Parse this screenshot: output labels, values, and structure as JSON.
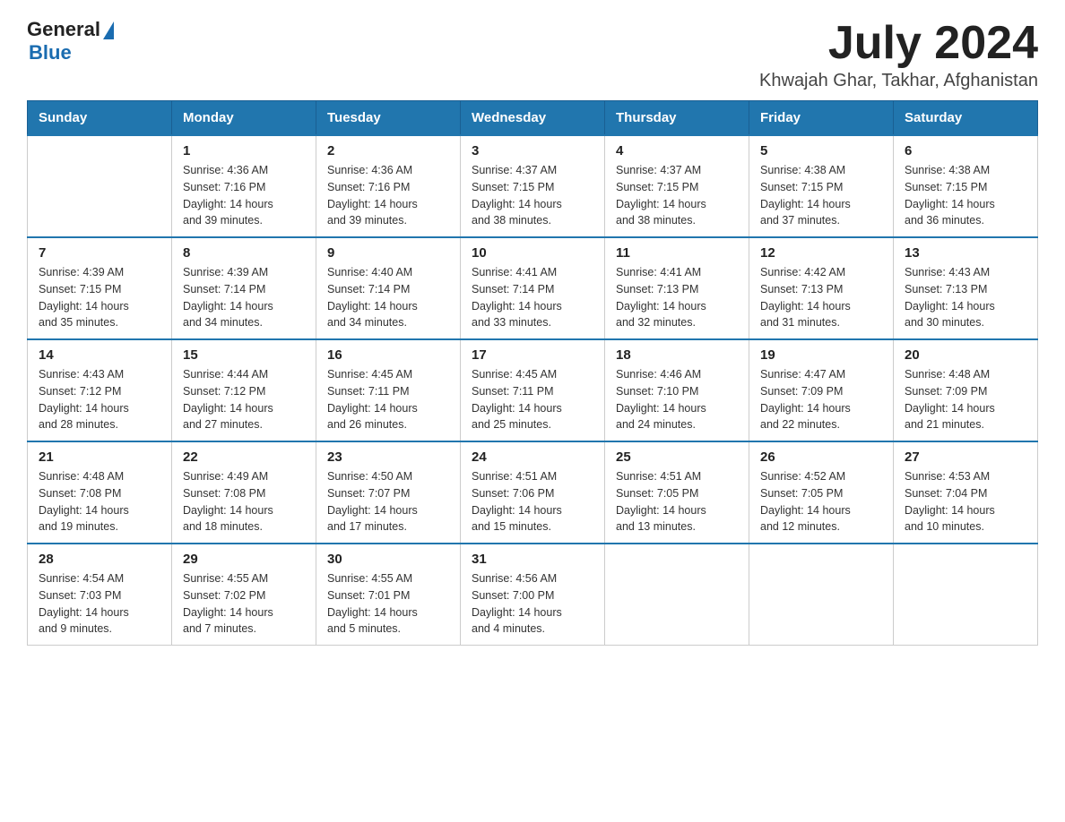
{
  "logo": {
    "text_general": "General",
    "text_blue": "Blue"
  },
  "title": "July 2024",
  "subtitle": "Khwajah Ghar, Takhar, Afghanistan",
  "headers": [
    "Sunday",
    "Monday",
    "Tuesday",
    "Wednesday",
    "Thursday",
    "Friday",
    "Saturday"
  ],
  "weeks": [
    [
      {
        "day": "",
        "info": ""
      },
      {
        "day": "1",
        "info": "Sunrise: 4:36 AM\nSunset: 7:16 PM\nDaylight: 14 hours\nand 39 minutes."
      },
      {
        "day": "2",
        "info": "Sunrise: 4:36 AM\nSunset: 7:16 PM\nDaylight: 14 hours\nand 39 minutes."
      },
      {
        "day": "3",
        "info": "Sunrise: 4:37 AM\nSunset: 7:15 PM\nDaylight: 14 hours\nand 38 minutes."
      },
      {
        "day": "4",
        "info": "Sunrise: 4:37 AM\nSunset: 7:15 PM\nDaylight: 14 hours\nand 38 minutes."
      },
      {
        "day": "5",
        "info": "Sunrise: 4:38 AM\nSunset: 7:15 PM\nDaylight: 14 hours\nand 37 minutes."
      },
      {
        "day": "6",
        "info": "Sunrise: 4:38 AM\nSunset: 7:15 PM\nDaylight: 14 hours\nand 36 minutes."
      }
    ],
    [
      {
        "day": "7",
        "info": "Sunrise: 4:39 AM\nSunset: 7:15 PM\nDaylight: 14 hours\nand 35 minutes."
      },
      {
        "day": "8",
        "info": "Sunrise: 4:39 AM\nSunset: 7:14 PM\nDaylight: 14 hours\nand 34 minutes."
      },
      {
        "day": "9",
        "info": "Sunrise: 4:40 AM\nSunset: 7:14 PM\nDaylight: 14 hours\nand 34 minutes."
      },
      {
        "day": "10",
        "info": "Sunrise: 4:41 AM\nSunset: 7:14 PM\nDaylight: 14 hours\nand 33 minutes."
      },
      {
        "day": "11",
        "info": "Sunrise: 4:41 AM\nSunset: 7:13 PM\nDaylight: 14 hours\nand 32 minutes."
      },
      {
        "day": "12",
        "info": "Sunrise: 4:42 AM\nSunset: 7:13 PM\nDaylight: 14 hours\nand 31 minutes."
      },
      {
        "day": "13",
        "info": "Sunrise: 4:43 AM\nSunset: 7:13 PM\nDaylight: 14 hours\nand 30 minutes."
      }
    ],
    [
      {
        "day": "14",
        "info": "Sunrise: 4:43 AM\nSunset: 7:12 PM\nDaylight: 14 hours\nand 28 minutes."
      },
      {
        "day": "15",
        "info": "Sunrise: 4:44 AM\nSunset: 7:12 PM\nDaylight: 14 hours\nand 27 minutes."
      },
      {
        "day": "16",
        "info": "Sunrise: 4:45 AM\nSunset: 7:11 PM\nDaylight: 14 hours\nand 26 minutes."
      },
      {
        "day": "17",
        "info": "Sunrise: 4:45 AM\nSunset: 7:11 PM\nDaylight: 14 hours\nand 25 minutes."
      },
      {
        "day": "18",
        "info": "Sunrise: 4:46 AM\nSunset: 7:10 PM\nDaylight: 14 hours\nand 24 minutes."
      },
      {
        "day": "19",
        "info": "Sunrise: 4:47 AM\nSunset: 7:09 PM\nDaylight: 14 hours\nand 22 minutes."
      },
      {
        "day": "20",
        "info": "Sunrise: 4:48 AM\nSunset: 7:09 PM\nDaylight: 14 hours\nand 21 minutes."
      }
    ],
    [
      {
        "day": "21",
        "info": "Sunrise: 4:48 AM\nSunset: 7:08 PM\nDaylight: 14 hours\nand 19 minutes."
      },
      {
        "day": "22",
        "info": "Sunrise: 4:49 AM\nSunset: 7:08 PM\nDaylight: 14 hours\nand 18 minutes."
      },
      {
        "day": "23",
        "info": "Sunrise: 4:50 AM\nSunset: 7:07 PM\nDaylight: 14 hours\nand 17 minutes."
      },
      {
        "day": "24",
        "info": "Sunrise: 4:51 AM\nSunset: 7:06 PM\nDaylight: 14 hours\nand 15 minutes."
      },
      {
        "day": "25",
        "info": "Sunrise: 4:51 AM\nSunset: 7:05 PM\nDaylight: 14 hours\nand 13 minutes."
      },
      {
        "day": "26",
        "info": "Sunrise: 4:52 AM\nSunset: 7:05 PM\nDaylight: 14 hours\nand 12 minutes."
      },
      {
        "day": "27",
        "info": "Sunrise: 4:53 AM\nSunset: 7:04 PM\nDaylight: 14 hours\nand 10 minutes."
      }
    ],
    [
      {
        "day": "28",
        "info": "Sunrise: 4:54 AM\nSunset: 7:03 PM\nDaylight: 14 hours\nand 9 minutes."
      },
      {
        "day": "29",
        "info": "Sunrise: 4:55 AM\nSunset: 7:02 PM\nDaylight: 14 hours\nand 7 minutes."
      },
      {
        "day": "30",
        "info": "Sunrise: 4:55 AM\nSunset: 7:01 PM\nDaylight: 14 hours\nand 5 minutes."
      },
      {
        "day": "31",
        "info": "Sunrise: 4:56 AM\nSunset: 7:00 PM\nDaylight: 14 hours\nand 4 minutes."
      },
      {
        "day": "",
        "info": ""
      },
      {
        "day": "",
        "info": ""
      },
      {
        "day": "",
        "info": ""
      }
    ]
  ]
}
